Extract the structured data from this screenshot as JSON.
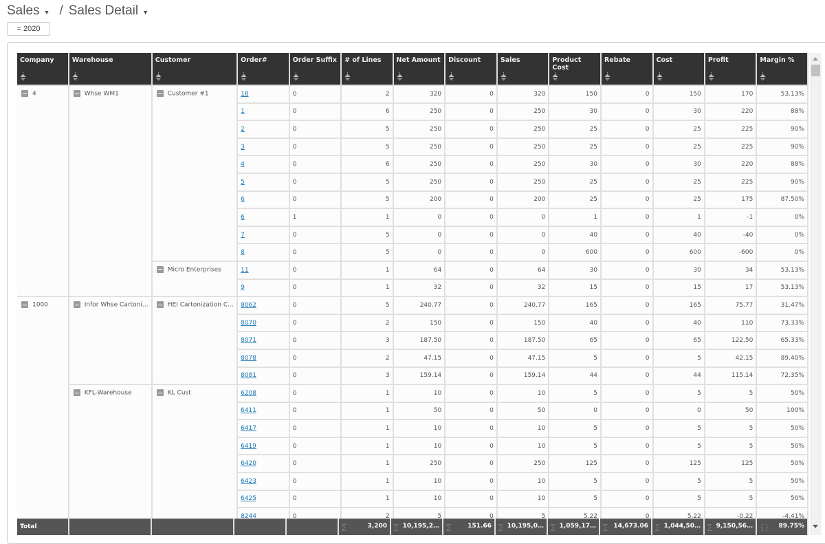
{
  "header": {
    "breadcrumbs": [
      {
        "label": "Sales",
        "icon": "caret-down-icon"
      },
      {
        "label": "Sales Detail",
        "icon": "caret-down-icon"
      }
    ],
    "separator": "/",
    "filter_chip": "= 2020"
  },
  "table": {
    "columns": [
      "Company",
      "Warehouse",
      "Customer",
      "Order#",
      "Order Suffix",
      "# of Lines",
      "Net Amount",
      "Discount",
      "Sales",
      "Product Cost",
      "Rebate",
      "Cost",
      "Profit",
      "Margin %"
    ],
    "groups": [
      {
        "company": "4",
        "warehouses": [
          {
            "name": "Whse WM1",
            "customers": [
              {
                "name": "Customer #1",
                "rows": [
                  [
                    "18",
                    "0",
                    "2",
                    "320",
                    "0",
                    "320",
                    "150",
                    "0",
                    "150",
                    "170",
                    "53.13%"
                  ],
                  [
                    "1",
                    "0",
                    "6",
                    "250",
                    "0",
                    "250",
                    "30",
                    "0",
                    "30",
                    "220",
                    "88%"
                  ],
                  [
                    "2",
                    "0",
                    "5",
                    "250",
                    "0",
                    "250",
                    "25",
                    "0",
                    "25",
                    "225",
                    "90%"
                  ],
                  [
                    "3",
                    "0",
                    "5",
                    "250",
                    "0",
                    "250",
                    "25",
                    "0",
                    "25",
                    "225",
                    "90%"
                  ],
                  [
                    "4",
                    "0",
                    "6",
                    "250",
                    "0",
                    "250",
                    "30",
                    "0",
                    "30",
                    "220",
                    "88%"
                  ],
                  [
                    "5",
                    "0",
                    "5",
                    "250",
                    "0",
                    "250",
                    "25",
                    "0",
                    "25",
                    "225",
                    "90%"
                  ],
                  [
                    "6",
                    "0",
                    "5",
                    "200",
                    "0",
                    "200",
                    "25",
                    "0",
                    "25",
                    "175",
                    "87.50%"
                  ],
                  [
                    "6",
                    "1",
                    "1",
                    "0",
                    "0",
                    "0",
                    "1",
                    "0",
                    "1",
                    "-1",
                    "0%"
                  ],
                  [
                    "7",
                    "0",
                    "5",
                    "0",
                    "0",
                    "0",
                    "40",
                    "0",
                    "40",
                    "-40",
                    "0%"
                  ],
                  [
                    "8",
                    "0",
                    "5",
                    "0",
                    "0",
                    "0",
                    "600",
                    "0",
                    "600",
                    "-600",
                    "0%"
                  ]
                ]
              },
              {
                "name": "Micro Enterprises",
                "rows": [
                  [
                    "11",
                    "0",
                    "1",
                    "64",
                    "0",
                    "64",
                    "30",
                    "0",
                    "30",
                    "34",
                    "53.13%"
                  ],
                  [
                    "9",
                    "0",
                    "1",
                    "32",
                    "0",
                    "32",
                    "15",
                    "0",
                    "15",
                    "17",
                    "53.13%"
                  ]
                ]
              }
            ]
          }
        ]
      },
      {
        "company": "1000",
        "warehouses": [
          {
            "name": "Infor Whse Cartoni…",
            "customers": [
              {
                "name": "HEI Cartonization C…",
                "rows": [
                  [
                    "8062",
                    "0",
                    "5",
                    "240.77",
                    "0",
                    "240.77",
                    "165",
                    "0",
                    "165",
                    "75.77",
                    "31.47%"
                  ],
                  [
                    "8070",
                    "0",
                    "2",
                    "150",
                    "0",
                    "150",
                    "40",
                    "0",
                    "40",
                    "110",
                    "73.33%"
                  ],
                  [
                    "8071",
                    "0",
                    "3",
                    "187.50",
                    "0",
                    "187.50",
                    "65",
                    "0",
                    "65",
                    "122.50",
                    "65.33%"
                  ],
                  [
                    "8078",
                    "0",
                    "2",
                    "47.15",
                    "0",
                    "47.15",
                    "5",
                    "0",
                    "5",
                    "42.15",
                    "89.40%"
                  ],
                  [
                    "8081",
                    "0",
                    "3",
                    "159.14",
                    "0",
                    "159.14",
                    "44",
                    "0",
                    "44",
                    "115.14",
                    "72.35%"
                  ]
                ]
              }
            ]
          },
          {
            "name": "KFL-Warehouse",
            "customers": [
              {
                "name": "KL Cust",
                "rows": [
                  [
                    "6208",
                    "0",
                    "1",
                    "10",
                    "0",
                    "10",
                    "5",
                    "0",
                    "5",
                    "5",
                    "50%"
                  ],
                  [
                    "6411",
                    "0",
                    "1",
                    "50",
                    "0",
                    "50",
                    "0",
                    "0",
                    "0",
                    "50",
                    "100%"
                  ],
                  [
                    "6417",
                    "0",
                    "1",
                    "10",
                    "0",
                    "10",
                    "5",
                    "0",
                    "5",
                    "5",
                    "50%"
                  ],
                  [
                    "6419",
                    "0",
                    "1",
                    "10",
                    "0",
                    "10",
                    "5",
                    "0",
                    "5",
                    "5",
                    "50%"
                  ],
                  [
                    "6420",
                    "0",
                    "1",
                    "250",
                    "0",
                    "250",
                    "125",
                    "0",
                    "125",
                    "125",
                    "50%"
                  ],
                  [
                    "6423",
                    "0",
                    "1",
                    "10",
                    "0",
                    "10",
                    "5",
                    "0",
                    "5",
                    "5",
                    "50%"
                  ],
                  [
                    "6425",
                    "0",
                    "1",
                    "10",
                    "0",
                    "10",
                    "5",
                    "0",
                    "5",
                    "5",
                    "50%"
                  ],
                  [
                    "8244",
                    "0",
                    "2",
                    "5",
                    "0",
                    "5",
                    "5.22",
                    "0",
                    "5.22",
                    "-0.22",
                    "-4.41%"
                  ]
                ]
              }
            ]
          }
        ]
      }
    ],
    "totals": {
      "label": "Total",
      "cells": [
        {
          "agg": "∑",
          "value": "3,200"
        },
        {
          "agg": "∑",
          "value": "10,195,2…"
        },
        {
          "agg": "∑",
          "value": "151.66"
        },
        {
          "agg": "∑",
          "value": "10,195,0…"
        },
        {
          "agg": "∑",
          "value": "1,059,17…"
        },
        {
          "agg": "∑",
          "value": "14,673.06"
        },
        {
          "agg": "∑",
          "value": "1,044,50…"
        },
        {
          "agg": "∑",
          "value": "9,150,56…"
        },
        {
          "agg": "{}",
          "value": "89.75%"
        }
      ]
    }
  }
}
